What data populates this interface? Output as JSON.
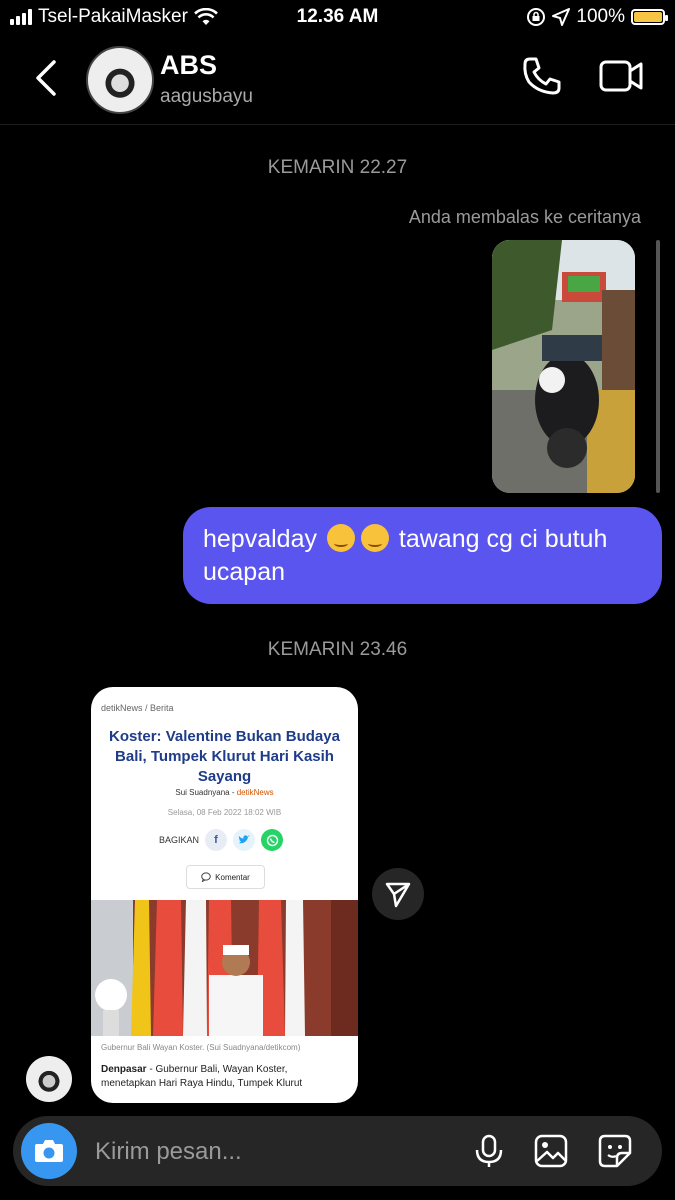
{
  "status_bar": {
    "carrier": "Tsel-PakaiMasker",
    "time": "12.36 AM",
    "battery": "100%",
    "battery_color": "#f6c544"
  },
  "header": {
    "name": "ABS",
    "username": "aagusbayu",
    "icons": [
      "back-chevron-icon",
      "phone-icon",
      "video-camera-icon"
    ]
  },
  "chat": {
    "timestamp_1": "KEMARIN 22.27",
    "reply_note": "Anda membalas ke ceritanya",
    "message": {
      "text_before": "hepvalday",
      "text_after": "tawang cg ci butuh ucapan",
      "bubble_color": "#5b55f0"
    },
    "timestamp_2": "KEMARIN 23.46",
    "shared_article": {
      "breadcrumb": "detikNews / Berita",
      "headline": "Koster: Valentine Bukan Budaya Bali, Tumpek Klurut Hari Kasih Sayang",
      "author": "Sui Suadnyana",
      "outlet": "detikNews",
      "date": "Selasa, 08 Feb 2022 18:02 WIB",
      "share_label": "BAGIKAN",
      "comment_label": "Komentar",
      "caption": "Gubernur Bali Wayan Koster. (Sui Suadnyana/detikcom)",
      "body_lead": "Denpasar",
      "body_text": " - Gubernur Bali, Wayan Koster, menetapkan Hari Raya Hindu, Tumpek Klurut"
    }
  },
  "composer": {
    "placeholder": "Kirim pesan...",
    "accent_color": "#3797f0",
    "icons": [
      "camera-icon",
      "microphone-icon",
      "gallery-icon",
      "sticker-icon"
    ]
  }
}
